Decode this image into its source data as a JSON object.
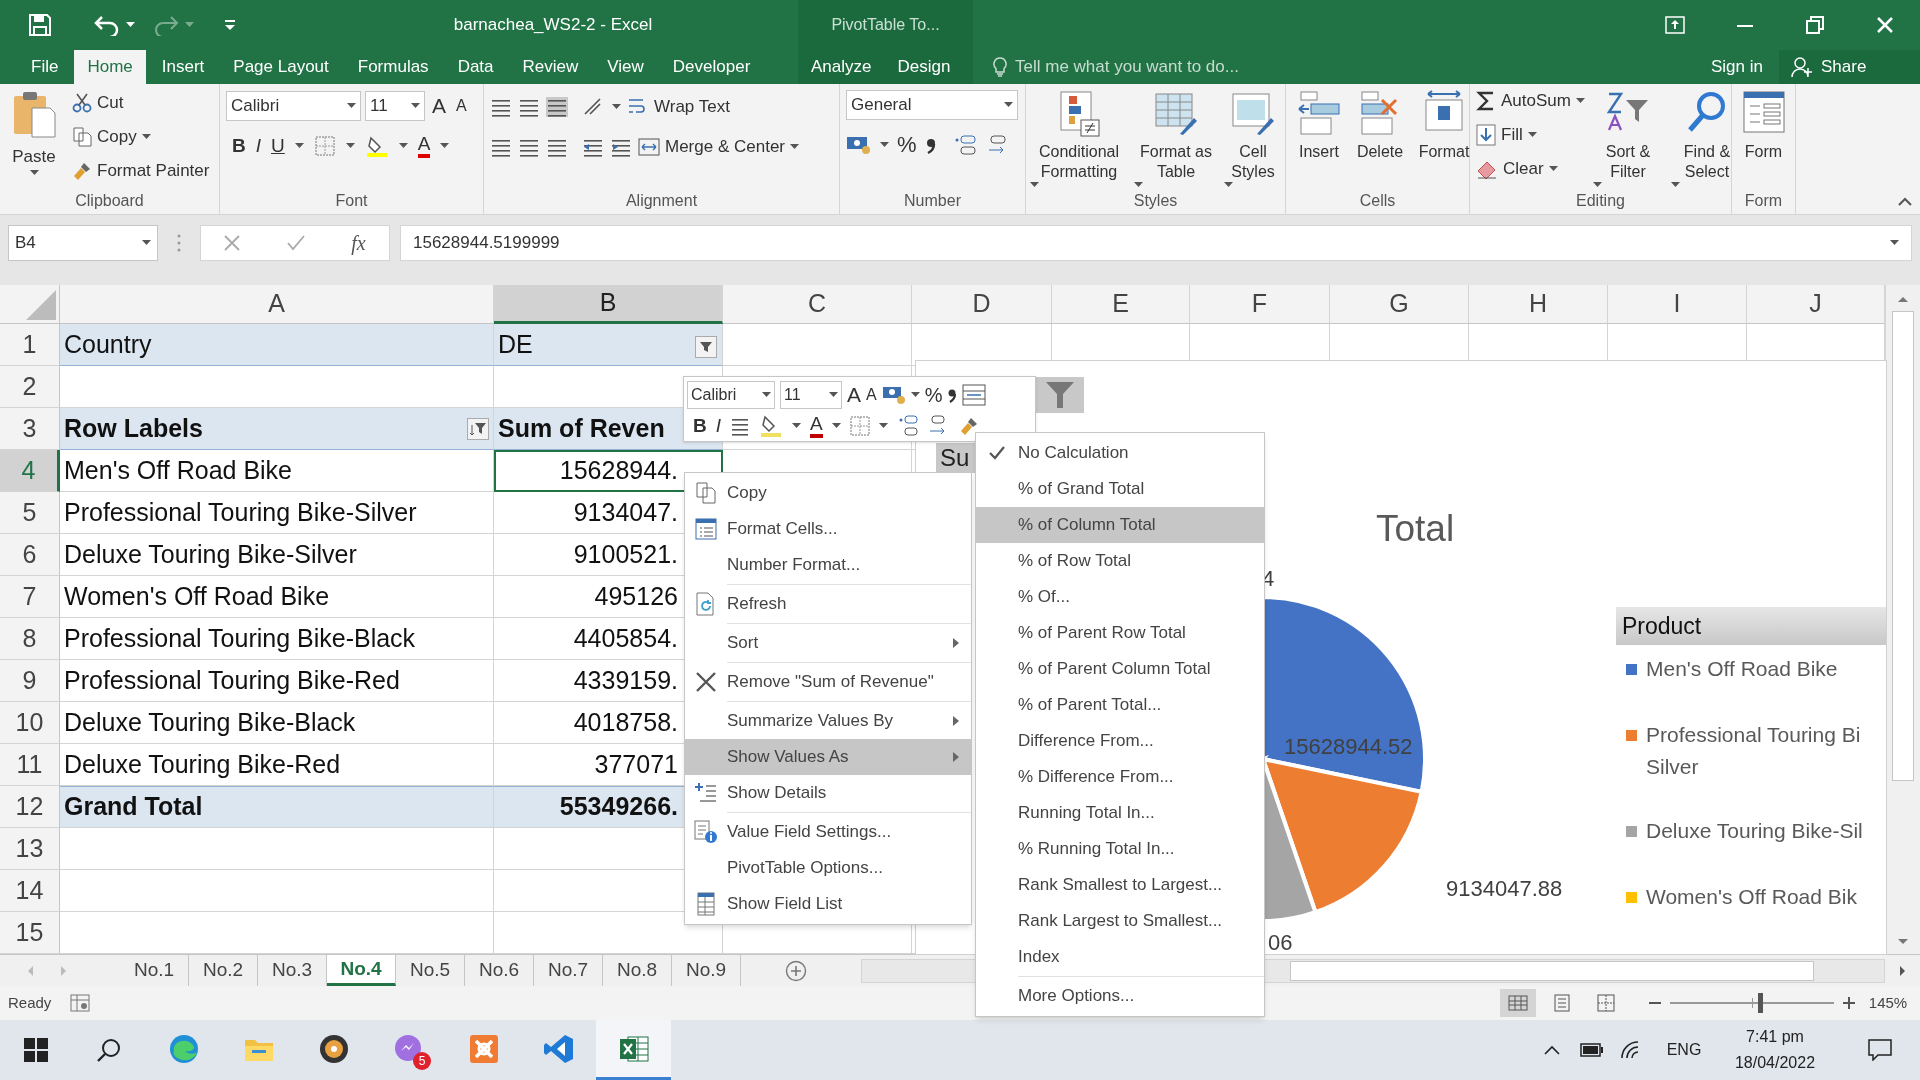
{
  "title_bar": {
    "title": "barnachea_WS2-2 - Excel",
    "contextual_group": "PivotTable To..."
  },
  "ribbon_tabs": [
    {
      "label": "File",
      "selected": false
    },
    {
      "label": "Home",
      "selected": true
    },
    {
      "label": "Insert",
      "selected": false
    },
    {
      "label": "Page Layout",
      "selected": false
    },
    {
      "label": "Formulas",
      "selected": false
    },
    {
      "label": "Data",
      "selected": false
    },
    {
      "label": "Review",
      "selected": false
    },
    {
      "label": "View",
      "selected": false
    },
    {
      "label": "Developer",
      "selected": false
    },
    {
      "label": "Analyze",
      "selected": false
    },
    {
      "label": "Design",
      "selected": false
    }
  ],
  "tell_me": {
    "placeholder": "Tell me what you want to do..."
  },
  "account": {
    "sign_in": "Sign in",
    "share": "Share"
  },
  "ribbon": {
    "clipboard": {
      "paste": "Paste",
      "cut": "Cut",
      "copy": "Copy",
      "format_painter": "Format Painter",
      "label": "Clipboard"
    },
    "font": {
      "name": "Calibri",
      "size": "11",
      "grow": "A",
      "shrink": "A",
      "bold": "B",
      "italic": "I",
      "underline": "U",
      "font_color": "A",
      "label": "Font"
    },
    "alignment": {
      "wrap_text": "Wrap Text",
      "merge": "Merge & Center",
      "label": "Alignment"
    },
    "number": {
      "format": "General",
      "percent": "%",
      "label": "Number"
    },
    "styles": {
      "buttons": [
        "Conditional Formatting",
        "Format as Table",
        "Cell Styles"
      ],
      "label": "Styles"
    },
    "cells": {
      "buttons": [
        "Insert",
        "Delete",
        "Format"
      ],
      "label": "Cells"
    },
    "editing": {
      "autosum": "AutoSum",
      "fill": "Fill",
      "clear": "Clear",
      "sort_filter": "Sort & Filter",
      "find_select": "Find & Select",
      "label": "Editing"
    },
    "form": {
      "button": "Form",
      "label": "Form"
    }
  },
  "formula_bar": {
    "name_box": "B4",
    "fx": "fx",
    "value": "15628944.5199999"
  },
  "columns": [
    {
      "label": "A",
      "selected": false
    },
    {
      "label": "B",
      "selected": true
    },
    {
      "label": "C",
      "selected": false
    },
    {
      "label": "D",
      "selected": false
    },
    {
      "label": "E",
      "selected": false
    },
    {
      "label": "F",
      "selected": false
    },
    {
      "label": "G",
      "selected": false
    },
    {
      "label": "H",
      "selected": false
    },
    {
      "label": "I",
      "selected": false
    },
    {
      "label": "J",
      "selected": false
    }
  ],
  "rows": [
    {
      "number": "1",
      "selected": false,
      "kind": "filter",
      "a": "Country",
      "b": "DE"
    },
    {
      "number": "2",
      "selected": false,
      "kind": "empty"
    },
    {
      "number": "3",
      "selected": false,
      "kind": "header",
      "a": "Row Labels",
      "b": "Sum of Reven"
    },
    {
      "number": "4",
      "selected": true,
      "kind": "item",
      "a": "Men's Off Road Bike",
      "b": "15628944."
    },
    {
      "number": "5",
      "selected": false,
      "kind": "item",
      "a": "Professional Touring Bike-Silver",
      "b": "9134047."
    },
    {
      "number": "6",
      "selected": false,
      "kind": "item",
      "a": "Deluxe Touring Bike-Silver",
      "b": "9100521."
    },
    {
      "number": "7",
      "selected": false,
      "kind": "item",
      "a": "Women's Off Road Bike",
      "b": "495126"
    },
    {
      "number": "8",
      "selected": false,
      "kind": "item",
      "a": "Professional Touring Bike-Black",
      "b": "4405854."
    },
    {
      "number": "9",
      "selected": false,
      "kind": "item",
      "a": "Professional Touring Bike-Red",
      "b": "4339159."
    },
    {
      "number": "10",
      "selected": false,
      "kind": "item",
      "a": "Deluxe Touring Bike-Black",
      "b": "4018758."
    },
    {
      "number": "11",
      "selected": false,
      "kind": "item",
      "a": "Deluxe Touring Bike-Red",
      "b": "377071"
    },
    {
      "number": "12",
      "selected": false,
      "kind": "total",
      "a": "Grand Total",
      "b": "55349266."
    },
    {
      "number": "13",
      "selected": false,
      "kind": "empty"
    },
    {
      "number": "14",
      "selected": false,
      "kind": "empty"
    },
    {
      "number": "15",
      "selected": false,
      "kind": "empty"
    }
  ],
  "chart": {
    "field_button": "Su",
    "title": "Total",
    "data_labels": [
      "4",
      "15628944.52",
      "9134047.88",
      "06"
    ],
    "legend": {
      "title": "Product",
      "items": [
        {
          "lines": [
            "Men's Off Road Bike"
          ],
          "color": "#4472c4"
        },
        {
          "lines": [
            "Professional Touring Bi",
            "Silver"
          ],
          "color": "#ed7d31"
        },
        {
          "lines": [
            "Deluxe Touring Bike-Sil"
          ],
          "color": "#a5a5a5"
        },
        {
          "lines": [
            "Women's Off Road Bik"
          ],
          "color": "#ffc000"
        }
      ]
    }
  },
  "mini_toolbar": {
    "font": "Calibri",
    "size": "11",
    "grow": "A",
    "shrink": "A",
    "percent": "%",
    "bold": "B",
    "italic": "I",
    "font_color": "A"
  },
  "context_menu": {
    "items": [
      {
        "label": "Copy",
        "kind": "copy",
        "selected": false,
        "divider": false
      },
      {
        "label": "Format Cells...",
        "kind": "format",
        "selected": false,
        "divider": false
      },
      {
        "label": "Number Format...",
        "kind": "plain",
        "selected": false,
        "divider": true
      },
      {
        "label": "Refresh",
        "kind": "refresh",
        "selected": false,
        "divider": true
      },
      {
        "label": "Sort",
        "kind": "submenu",
        "selected": false,
        "divider": true
      },
      {
        "label": "Remove \"Sum of Revenue\"",
        "kind": "remove",
        "selected": false,
        "divider": true
      },
      {
        "label": "Summarize Values By",
        "kind": "submenu",
        "selected": false,
        "divider": false
      },
      {
        "label": "Show Values As",
        "kind": "submenu",
        "selected": true,
        "divider": false
      },
      {
        "label": "Show Details",
        "kind": "details",
        "selected": false,
        "divider": true
      },
      {
        "label": "Value Field Settings...",
        "kind": "settings",
        "selected": false,
        "divider": false
      },
      {
        "label": "PivotTable Options...",
        "kind": "plain",
        "selected": false,
        "divider": false
      },
      {
        "label": "Show Field List",
        "kind": "fieldlist",
        "selected": false,
        "divider": false
      }
    ]
  },
  "submenu": {
    "items": [
      {
        "label": "No Calculation",
        "checked": true,
        "selected": false,
        "divider": false
      },
      {
        "label": "% of Grand Total",
        "checked": false,
        "selected": false,
        "divider": false
      },
      {
        "label": "% of Column Total",
        "checked": false,
        "selected": true,
        "divider": false
      },
      {
        "label": "% of Row Total",
        "checked": false,
        "selected": false,
        "divider": false
      },
      {
        "label": "% Of...",
        "checked": false,
        "selected": false,
        "divider": false
      },
      {
        "label": "% of Parent Row Total",
        "checked": false,
        "selected": false,
        "divider": false
      },
      {
        "label": "% of Parent Column Total",
        "checked": false,
        "selected": false,
        "divider": false
      },
      {
        "label": "% of Parent Total...",
        "checked": false,
        "selected": false,
        "divider": false
      },
      {
        "label": "Difference From...",
        "checked": false,
        "selected": false,
        "divider": false
      },
      {
        "label": "% Difference From...",
        "checked": false,
        "selected": false,
        "divider": false
      },
      {
        "label": "Running Total In...",
        "checked": false,
        "selected": false,
        "divider": false
      },
      {
        "label": "% Running Total In...",
        "checked": false,
        "selected": false,
        "divider": false
      },
      {
        "label": "Rank Smallest to Largest...",
        "checked": false,
        "selected": false,
        "divider": false
      },
      {
        "label": "Rank Largest to Smallest...",
        "checked": false,
        "selected": false,
        "divider": false
      },
      {
        "label": "Index",
        "checked": false,
        "selected": false,
        "divider": true
      },
      {
        "label": "More Options...",
        "checked": false,
        "selected": false,
        "divider": false
      }
    ]
  },
  "sheet_tabs": [
    {
      "label": "No.1",
      "selected": false
    },
    {
      "label": "No.2",
      "selected": false
    },
    {
      "label": "No.3",
      "selected": false
    },
    {
      "label": "No.4",
      "selected": true
    },
    {
      "label": "No.5",
      "selected": false
    },
    {
      "label": "No.6",
      "selected": false
    },
    {
      "label": "No.7",
      "selected": false
    },
    {
      "label": "No.8",
      "selected": false
    },
    {
      "label": "No.9",
      "selected": false
    }
  ],
  "status_bar": {
    "status": "Ready",
    "view_buttons": [
      {
        "kind": "normal",
        "selected": true
      },
      {
        "kind": "page_layout",
        "selected": false
      },
      {
        "kind": "page_break",
        "selected": false
      }
    ],
    "zoom": {
      "level": 0.55,
      "reading": "145%"
    }
  },
  "taskbar": {
    "apps": [
      {
        "kind": "browser",
        "active": false
      },
      {
        "kind": "folder",
        "active": false
      },
      {
        "kind": "disc",
        "active": false
      },
      {
        "kind": "chat",
        "active": false,
        "badge": "5"
      },
      {
        "kind": "server",
        "active": false
      },
      {
        "kind": "editor",
        "active": false
      },
      {
        "kind": "spreadsheet",
        "active": true
      }
    ],
    "language": "ENG",
    "time": "7:41 pm",
    "date": "18/04/2022"
  }
}
